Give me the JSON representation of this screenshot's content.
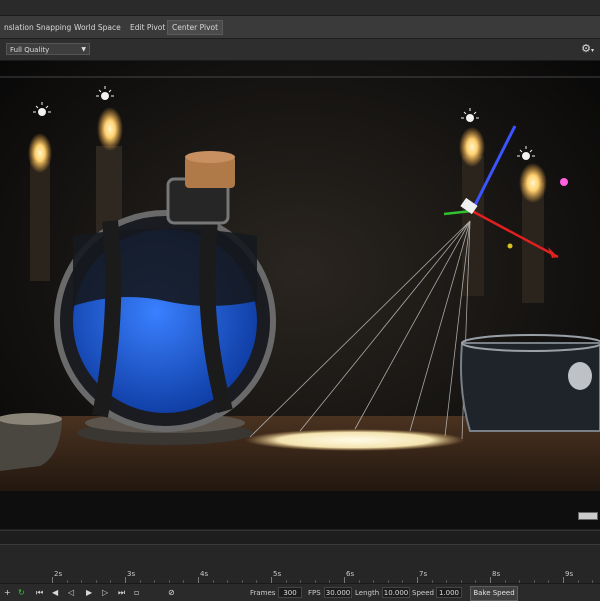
{
  "toolbar": {
    "translation_snapping": "nslation Snapping",
    "world_space": "World Space",
    "edit_pivot": "Edit Pivot",
    "center_pivot": "Center Pivot"
  },
  "viewport": {
    "quality_select": "Full Quality",
    "settings_icon": "gear-icon"
  },
  "timeline": {
    "ticks": [
      "2s",
      "3s",
      "4s",
      "5s",
      "6s",
      "7s",
      "8s",
      "9s"
    ]
  },
  "playback": {
    "frames_label": "Frames",
    "frames_value": "300",
    "fps_label": "FPS",
    "fps_value": "30.000",
    "length_label": "Length",
    "length_value": "10.000",
    "speed_label": "Speed",
    "speed_value": "1.000",
    "bake_speed": "Bake Speed"
  },
  "colors": {
    "toolbar_bg": "#3a3a3a",
    "panel_bg": "#262626",
    "potion_blue": "#1f5fd0",
    "light_glow": "#ffd98a",
    "gizmo_blue": "#3a55ff",
    "gizmo_red": "#e02020",
    "gizmo_green": "#30c030"
  }
}
